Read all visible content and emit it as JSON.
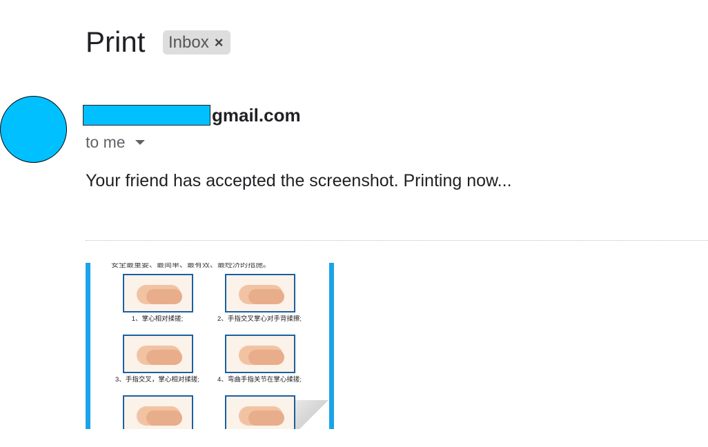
{
  "email": {
    "subject": "Print",
    "label_chip": "Inbox",
    "label_chip_close": "×",
    "sender_visible": "gmail.com",
    "recipient": "to me",
    "body": "Your friend has accepted the screenshot. Printing now..."
  },
  "attachment": {
    "header_text": "安全最重要、最简单、最有效、最经济的措施。",
    "steps": [
      {
        "caption": "1、掌心相对揉搓;"
      },
      {
        "caption": "2、手指交叉掌心对手背揉擦;"
      },
      {
        "caption": "3、手指交叉，掌心相对揉搓;"
      },
      {
        "caption": "4、弯曲手指关节在掌心揉搓;"
      }
    ]
  },
  "colors": {
    "avatar": "#00c0ff",
    "redaction": "#00c0ff",
    "attachment_border": "#1aa3e8"
  }
}
